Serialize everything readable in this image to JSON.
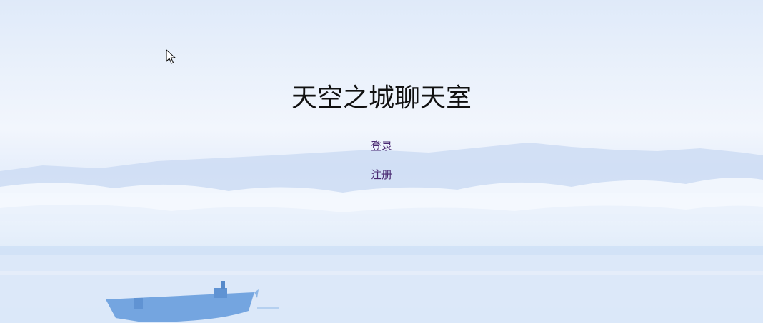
{
  "page": {
    "title": "天空之城聊天室"
  },
  "links": {
    "login": "登录",
    "register": "注册"
  },
  "icons": {
    "cursor": "mouse-pointer-icon",
    "background": "sky-sea-boat-scenery"
  },
  "colors": {
    "title": "#111111",
    "link": "#4a2a72",
    "sky": "#eaf1fb",
    "boat": "#6fa2df"
  }
}
